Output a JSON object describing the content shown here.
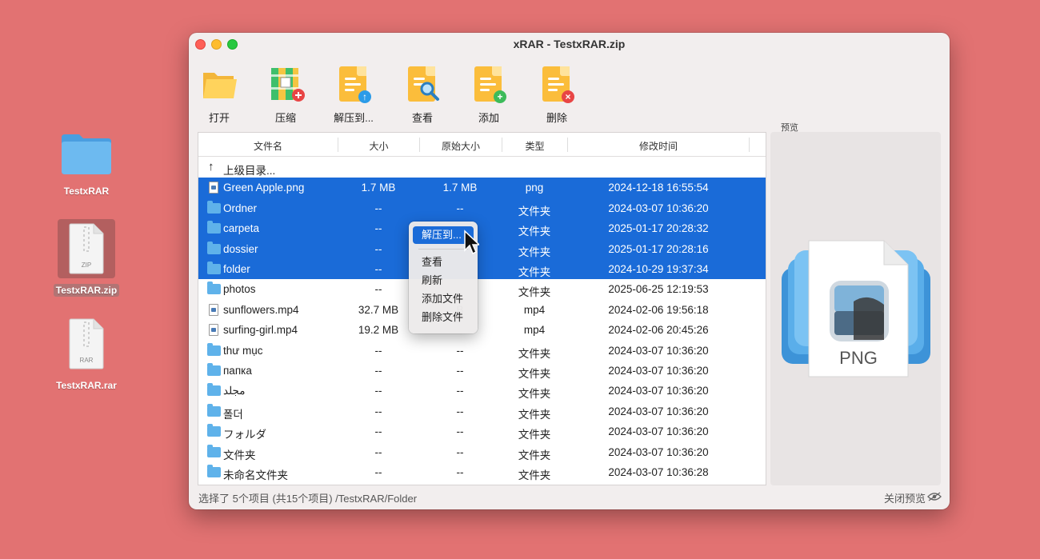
{
  "desktop": {
    "items": [
      {
        "label": "TestxRAR",
        "kind": "folder"
      },
      {
        "label": "TestxRAR.zip",
        "kind": "zip",
        "badge": "ZIP"
      },
      {
        "label": "TestxRAR.rar",
        "kind": "rar",
        "badge": "RAR"
      }
    ]
  },
  "window": {
    "title": "xRAR - TestxRAR.zip"
  },
  "toolbar": {
    "open": "打开",
    "compress": "压缩",
    "extract": "解压到...",
    "view": "查看",
    "add": "添加",
    "delete": "删除"
  },
  "table": {
    "columns": [
      "文件名",
      "大小",
      "原始大小",
      "类型",
      "修改时间"
    ],
    "parent_dir": "上级目录...",
    "rows": [
      {
        "name": "Green Apple.png",
        "size": "1.7 MB",
        "orig": "1.7 MB",
        "type": "png",
        "time": "2024-12-18 16:55:54",
        "icon": "file",
        "selected": true
      },
      {
        "name": "Ordner",
        "size": "--",
        "orig": "--",
        "type": "文件夹",
        "time": "2024-03-07 10:36:20",
        "icon": "folder",
        "selected": true
      },
      {
        "name": "carpeta",
        "size": "--",
        "orig": "",
        "type": "文件夹",
        "time": "2025-01-17 20:28:32",
        "icon": "folder",
        "selected": true
      },
      {
        "name": "dossier",
        "size": "--",
        "orig": "",
        "type": "文件夹",
        "time": "2025-01-17 20:28:16",
        "icon": "folder",
        "selected": true
      },
      {
        "name": "folder",
        "size": "--",
        "orig": "",
        "type": "文件夹",
        "time": "2024-10-29 19:37:34",
        "icon": "folder",
        "selected": true
      },
      {
        "name": "photos",
        "size": "--",
        "orig": "",
        "type": "文件夹",
        "time": "2025-06-25 12:19:53",
        "icon": "folder",
        "selected": false
      },
      {
        "name": "sunflowers.mp4",
        "size": "32.7 MB",
        "orig": "B",
        "type": "mp4",
        "time": "2024-02-06 19:56:18",
        "icon": "file",
        "selected": false
      },
      {
        "name": "surfing-girl.mp4",
        "size": "19.2 MB",
        "orig": "",
        "type": "mp4",
        "time": "2024-02-06 20:45:26",
        "icon": "file",
        "selected": false
      },
      {
        "name": "thư mục",
        "size": "--",
        "orig": "--",
        "type": "文件夹",
        "time": "2024-03-07 10:36:20",
        "icon": "folder",
        "selected": false
      },
      {
        "name": "папка",
        "size": "--",
        "orig": "--",
        "type": "文件夹",
        "time": "2024-03-07 10:36:20",
        "icon": "folder",
        "selected": false
      },
      {
        "name": "مجلد",
        "size": "--",
        "orig": "--",
        "type": "文件夹",
        "time": "2024-03-07 10:36:20",
        "icon": "folder",
        "selected": false
      },
      {
        "name": "폴더",
        "size": "--",
        "orig": "--",
        "type": "文件夹",
        "time": "2024-03-07 10:36:20",
        "icon": "folder",
        "selected": false
      },
      {
        "name": "フォルダ",
        "size": "--",
        "orig": "--",
        "type": "文件夹",
        "time": "2024-03-07 10:36:20",
        "icon": "folder",
        "selected": false
      },
      {
        "name": "文件夹",
        "size": "--",
        "orig": "--",
        "type": "文件夹",
        "time": "2024-03-07 10:36:20",
        "icon": "folder",
        "selected": false
      },
      {
        "name": "未命名文件夹",
        "size": "--",
        "orig": "--",
        "type": "文件夹",
        "time": "2024-03-07 10:36:28",
        "icon": "folder",
        "selected": false
      }
    ]
  },
  "context_menu": {
    "items": [
      "解压到...",
      "查看",
      "刷新",
      "添加文件",
      "删除文件"
    ]
  },
  "preview": {
    "label": "预览",
    "file_type": "PNG"
  },
  "status": {
    "text": "选择了 5个项目 (共15个项目) /TestxRAR/Folder",
    "close_preview": "关闭预览"
  },
  "colors": {
    "desktop": "#e27272",
    "selection": "#1a6bd8",
    "folder": "#5fb2ea"
  }
}
